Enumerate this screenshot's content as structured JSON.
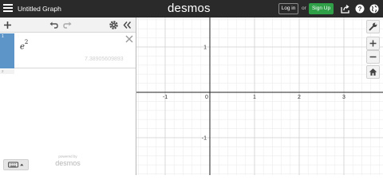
{
  "header": {
    "title": "Untitled Graph",
    "logo": "desmos",
    "login_label": "Log in",
    "or_label": "or",
    "signup_label": "Sign Up",
    "icons": [
      "menu-icon",
      "share-icon",
      "help-icon",
      "language-icon"
    ]
  },
  "toolbar": {
    "icons": [
      "add-icon",
      "undo-icon",
      "redo-icon",
      "settings-icon",
      "collapse-icon"
    ]
  },
  "expressions": [
    {
      "number": "1",
      "base": "e",
      "exponent": "2",
      "hint": "7.38905609893",
      "color": "#5e95c9"
    },
    {
      "number": "2"
    }
  ],
  "footer": {
    "keyboard_icon": "keyboard-icon",
    "powered_by": "powered by",
    "brand": "desmos"
  },
  "graph": {
    "x_ticks": [
      "-1",
      "0",
      "1",
      "2",
      "3"
    ],
    "y_ticks": [
      "1",
      "-1"
    ],
    "controls": [
      "wrench-icon",
      "zoom-in-icon",
      "zoom-out-icon",
      "home-icon"
    ]
  },
  "colors": {
    "header_bg": "#2a2a2a",
    "signup_green": "#2f9f48",
    "expression_blue": "#5e95c9",
    "grid_minor": "#ececec",
    "grid_major": "#cfcfcf",
    "axis": "#222222"
  }
}
